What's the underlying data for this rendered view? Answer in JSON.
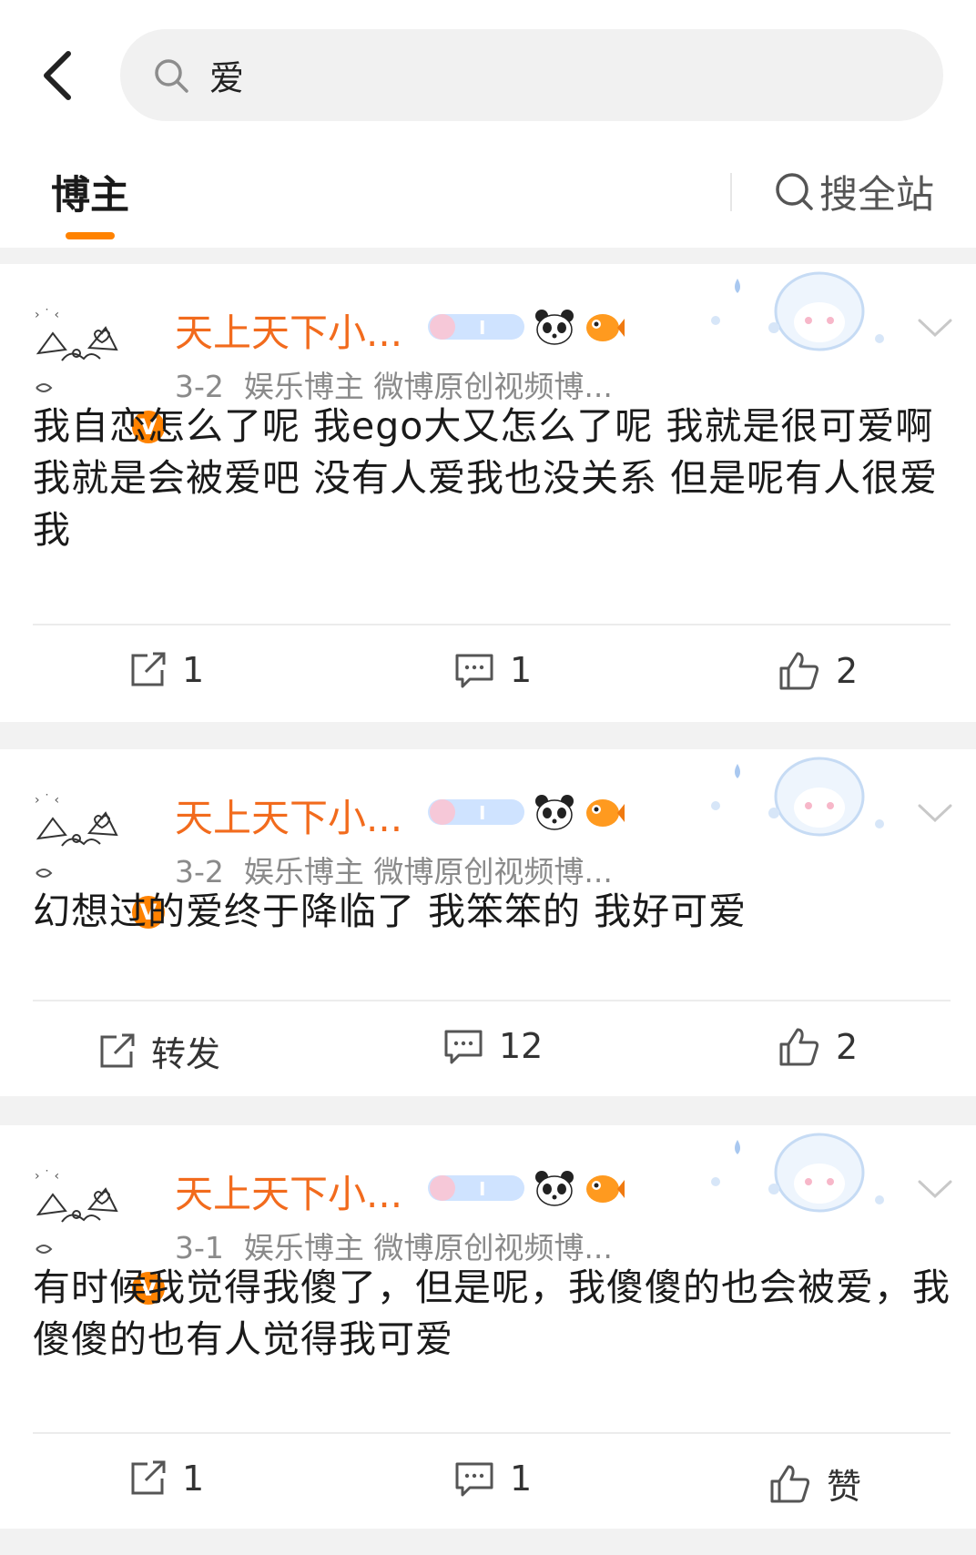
{
  "search": {
    "query": "爱"
  },
  "tabs": {
    "active": "博主",
    "search_all": "搜全站"
  },
  "posts": [
    {
      "name": "天上天下小...",
      "date": "3-2",
      "tags": "娱乐博主 微博原创视频博...",
      "content": "我自恋怎么了呢 我ego大又怎么了呢 我就是很可爱啊 我就是会被爱吧 没有人爱我也没关系 但是呢有人很爱我",
      "repost": "1",
      "comments": "1",
      "likes": "2"
    },
    {
      "name": "天上天下小...",
      "date": "3-2",
      "tags": "娱乐博主 微博原创视频博...",
      "content": "幻想过的爱终于降临了 我笨笨的 我好可爱",
      "repost": "转发",
      "comments": "12",
      "likes": "2"
    },
    {
      "name": "天上天下小...",
      "date": "3-1",
      "tags": "娱乐博主 微博原创视频博...",
      "content": "有时候我觉得我傻了，但是呢，我傻傻的也会被爱，我傻傻的也有人觉得我可爱",
      "repost": "1",
      "comments": "1",
      "likes": "赞"
    }
  ],
  "badges": {
    "verified": "V",
    "member": "I"
  },
  "colors": {
    "accent": "#ff8200",
    "name": "#f26b1d",
    "meta": "#8a8a8a"
  },
  "icons": [
    "back-arrow-icon",
    "search-icon",
    "verified-badge-icon",
    "panda-icon",
    "fish-icon",
    "chevron-down-icon",
    "repost-icon",
    "comment-icon",
    "like-icon"
  ]
}
